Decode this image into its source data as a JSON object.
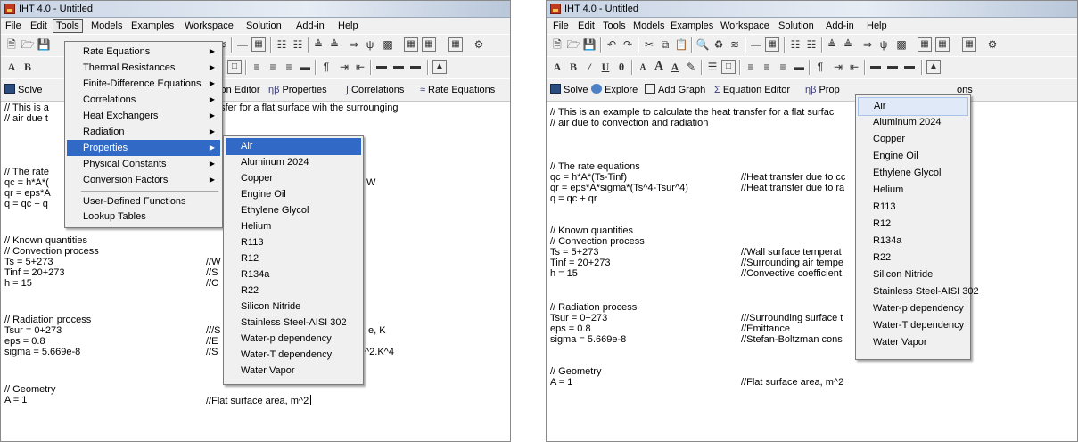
{
  "window_title": "IHT 4.0 - Untitled",
  "menu": [
    "File",
    "Edit",
    "Tools",
    "Models",
    "Examples",
    "Workspace",
    "Solution",
    "Add-in",
    "Help"
  ],
  "toolbar3": {
    "solve": "Solve",
    "explore": "Explore",
    "add_graph": "Add Graph",
    "equation_editor": "Equation Editor",
    "properties": "Properties",
    "correlations": "Correlations",
    "rate_equations": "Rate Equations"
  },
  "tools_menu": [
    "Rate Equations",
    "Thermal Resistances",
    "Finite-Difference Equations",
    "Correlations",
    "Heat Exchangers",
    "Radiation",
    "Properties",
    "Physical Constants",
    "Conversion Factors",
    "User-Defined Functions",
    "Lookup Tables"
  ],
  "properties_menu": [
    "Air",
    "Aluminum 2024",
    "Copper",
    "Engine Oil",
    "Ethylene Glycol",
    "Helium",
    "R113",
    "R12",
    "R134a",
    "R22",
    "Silicon Nitride",
    "Stainless Steel-AISI 302",
    "Water-p dependency",
    "Water-T dependency",
    "Water Vapor"
  ],
  "left_code": {
    "l1": "// This is a",
    "l1b": "nsfer for a flat surface wih the surrounging",
    "l2": "// air due t",
    "l4": "// The rate",
    "l5": "qc = h*A*(",
    "l5b": "W",
    "l6": "qr = eps*A",
    "l7": "q = qc + q",
    "l9": "// Known quantities",
    "l10": "// Convection process",
    "l11": "Ts = 5+273",
    "l11b": "//W",
    "l12": "Tinf = 20+273",
    "l12b": "//S",
    "l13": "h = 15",
    "l13b": "//C",
    "l15": "// Radiation process",
    "l16": "Tsur = 0+273",
    "l16b": "///S",
    "l16c": "e, K",
    "l17": "eps = 0.8",
    "l17b": "//E",
    "l18": "sigma = 5.669e-8",
    "l18b": "//S",
    "l18c": "^2.K^4",
    "l20": "// Geometry",
    "l21": "A = 1",
    "l21b": "//Flat surface area, m^2"
  },
  "right_code": {
    "l1": "// This is an example to calculate the heat transfer for a flat surfac",
    "l2": "// air due to convection and radiation",
    "l4": "// The rate equations",
    "l5": "qc = h*A*(Ts-Tinf)",
    "l5b": "//Heat transfer due to cc",
    "l6": "qr = eps*A*sigma*(Ts^4-Tsur^4)",
    "l6b": "//Heat transfer due to ra",
    "l7": "q = qc + qr",
    "l9": "// Known quantities",
    "l10": "// Convection process",
    "l11": "Ts = 5+273",
    "l11b": "//Wall surface temperat",
    "l12": "Tinf = 20+273",
    "l12b": "//Surrounding air tempe",
    "l13": "h = 15",
    "l13b": "//Convective coefficient,",
    "l15": "// Radiation process",
    "l16": "Tsur = 0+273",
    "l16b": "///Surrounding surface t",
    "l17": "eps = 0.8",
    "l17b": "//Emittance",
    "l18": "sigma = 5.669e-8",
    "l18b": "//Stefan-Boltzman cons",
    "l20": "// Geometry",
    "l21": "A = 1",
    "l21b": "//Flat surface area, m^2"
  },
  "right_toolbar_partial": {
    "properties": "Prop",
    "rate_tail": "ons"
  },
  "colors": {
    "highlight": "#3169c6",
    "menu_bg": "#f0f0f0",
    "app_icon": "#c03a22"
  }
}
